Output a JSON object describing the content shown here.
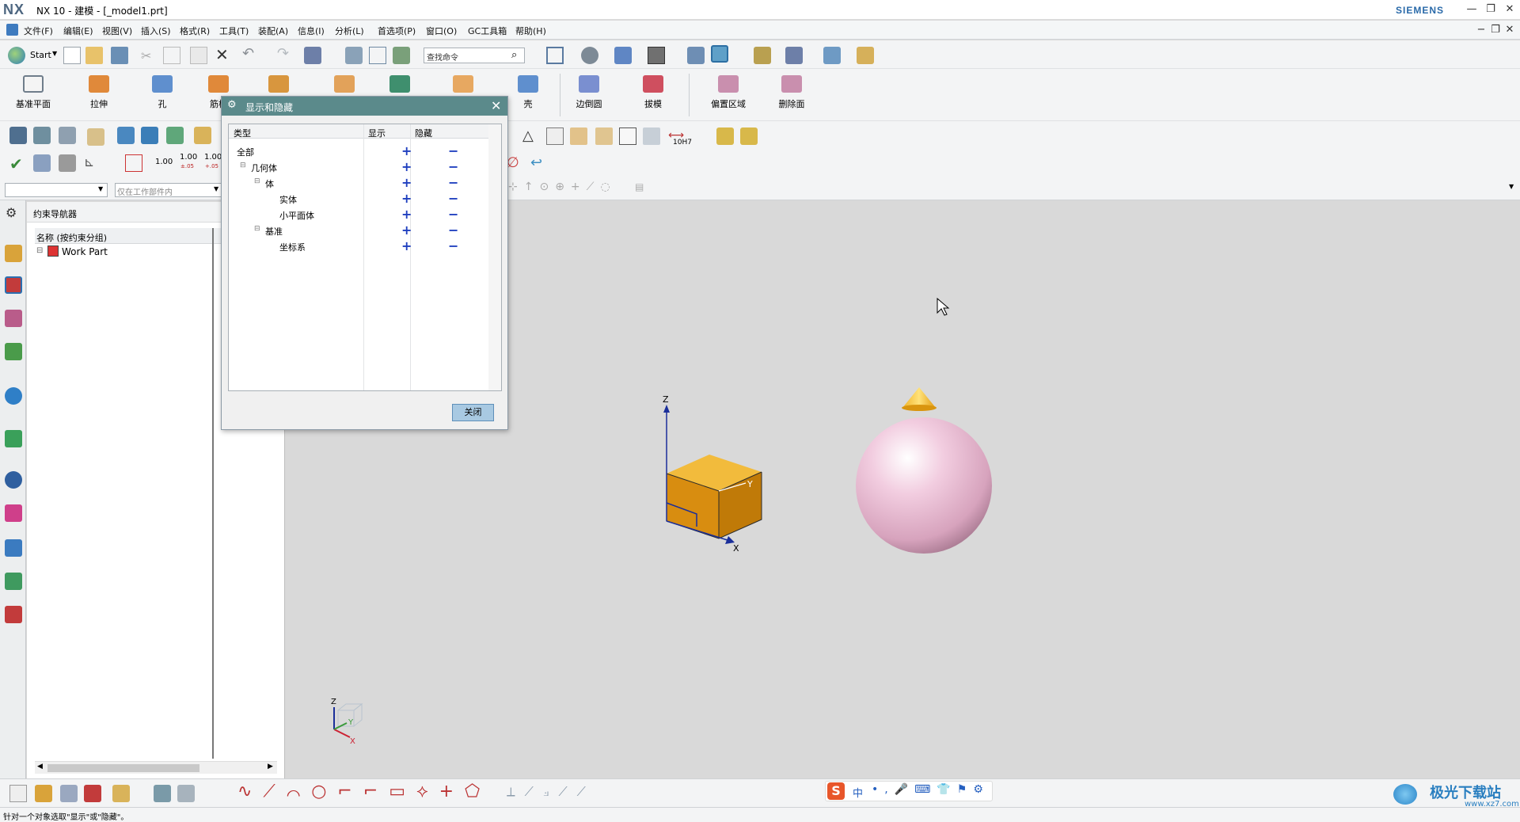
{
  "app": {
    "logo": "NX",
    "title": "NX 10 - 建模 - [_model1.prt]",
    "brand": "SIEMENS",
    "minimize": "—",
    "restore": "❐",
    "close": "✕"
  },
  "menu": {
    "items": [
      "文件(F)",
      "编辑(E)",
      "视图(V)",
      "插入(S)",
      "格式(R)",
      "工具(T)",
      "装配(A)",
      "信息(I)",
      "分析(L)",
      "首选项(P)",
      "窗口(O)",
      "GC工具箱",
      "帮助(H)"
    ]
  },
  "toolbar": {
    "start_label": "Start",
    "search_placeholder": "查找命令",
    "feature_buttons": [
      "基准平面",
      "拉伸",
      "孔",
      "筋板",
      "",
      "",
      "",
      "",
      "壳",
      "边倒圆",
      "拔模",
      "偏置区域",
      "删除面"
    ],
    "dim_values": [
      "1.00",
      "1.00",
      "1.00"
    ],
    "dim_sub": [
      "±.05",
      "+.05"
    ],
    "tolerance_label": "10H7",
    "filter_scope": "仅在工作部件内"
  },
  "navigator": {
    "title": "约束导航器",
    "column": "名称 (按约束分组)",
    "root_item": "Work Part"
  },
  "dialog": {
    "title": "显示和隐藏",
    "col_type": "类型",
    "col_show": "显示",
    "col_hide": "隐藏",
    "rows": [
      {
        "name": "全部",
        "indent": 0
      },
      {
        "name": "几何体",
        "indent": 1
      },
      {
        "name": "体",
        "indent": 2
      },
      {
        "name": "实体",
        "indent": 3
      },
      {
        "name": "小平面体",
        "indent": 3
      },
      {
        "name": "基准",
        "indent": 2
      },
      {
        "name": "坐标系",
        "indent": 3
      }
    ],
    "plus_symbol": "+",
    "minus_symbol": "−",
    "close_label": "关闭"
  },
  "viewport": {
    "axis_x": "X",
    "axis_y": "Y",
    "axis_z": "Z"
  },
  "ime": {
    "lang": "中"
  },
  "status": {
    "text": "针对一个对象选取\"显示\"或\"隐藏\"。"
  },
  "watermark": {
    "text": "极光下载站",
    "url": "www.xz7.com"
  },
  "colors": {
    "dialog_title": "#5b8a8b",
    "cube": "#e8a20c",
    "sphere": "#e7bfd4",
    "accent_blue": "#1f3fbf"
  }
}
